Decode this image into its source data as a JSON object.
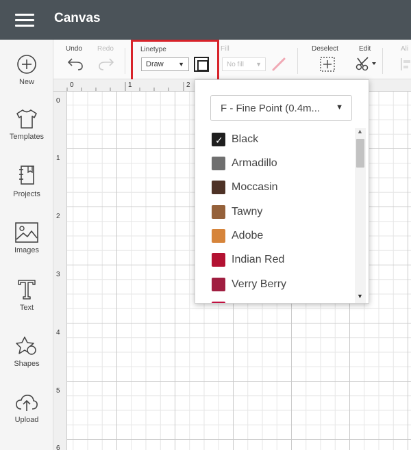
{
  "header": {
    "title": "Canvas"
  },
  "sidebar": {
    "items": [
      {
        "label": "New",
        "icon": "plus-circle-icon"
      },
      {
        "label": "Templates",
        "icon": "tshirt-icon"
      },
      {
        "label": "Projects",
        "icon": "notebook-icon"
      },
      {
        "label": "Images",
        "icon": "image-icon"
      },
      {
        "label": "Text",
        "icon": "text-t-icon"
      },
      {
        "label": "Shapes",
        "icon": "shapes-icon"
      },
      {
        "label": "Upload",
        "icon": "cloud-upload-icon"
      }
    ]
  },
  "toolbar": {
    "undo_label": "Undo",
    "redo_label": "Redo",
    "linetype_label": "Linetype",
    "linetype_value": "Draw",
    "fill_label": "Fill",
    "fill_value": "No fill",
    "deselect_label": "Deselect",
    "edit_label": "Edit",
    "align_label": "Ali"
  },
  "rulers": {
    "top": [
      "0",
      "1",
      "2"
    ],
    "left": [
      "0",
      "1",
      "2",
      "3",
      "4",
      "5",
      "6"
    ]
  },
  "dropdown": {
    "pen_type": "F - Fine Point (0.4m...",
    "selected": "Black",
    "colors": [
      {
        "name": "Black",
        "hex": "#1f1f1f"
      },
      {
        "name": "Armadillo",
        "hex": "#6f6f6f"
      },
      {
        "name": "Moccasin",
        "hex": "#4e3226"
      },
      {
        "name": "Tawny",
        "hex": "#95613a"
      },
      {
        "name": "Adobe",
        "hex": "#d6843a"
      },
      {
        "name": "Indian Red",
        "hex": "#b31232"
      },
      {
        "name": "Verry Berry",
        "hex": "#a01e40"
      },
      {
        "name": "",
        "hex": "#c01040"
      }
    ]
  },
  "colors": {
    "header_bg": "#4b5359",
    "highlight": "#d8232a"
  }
}
